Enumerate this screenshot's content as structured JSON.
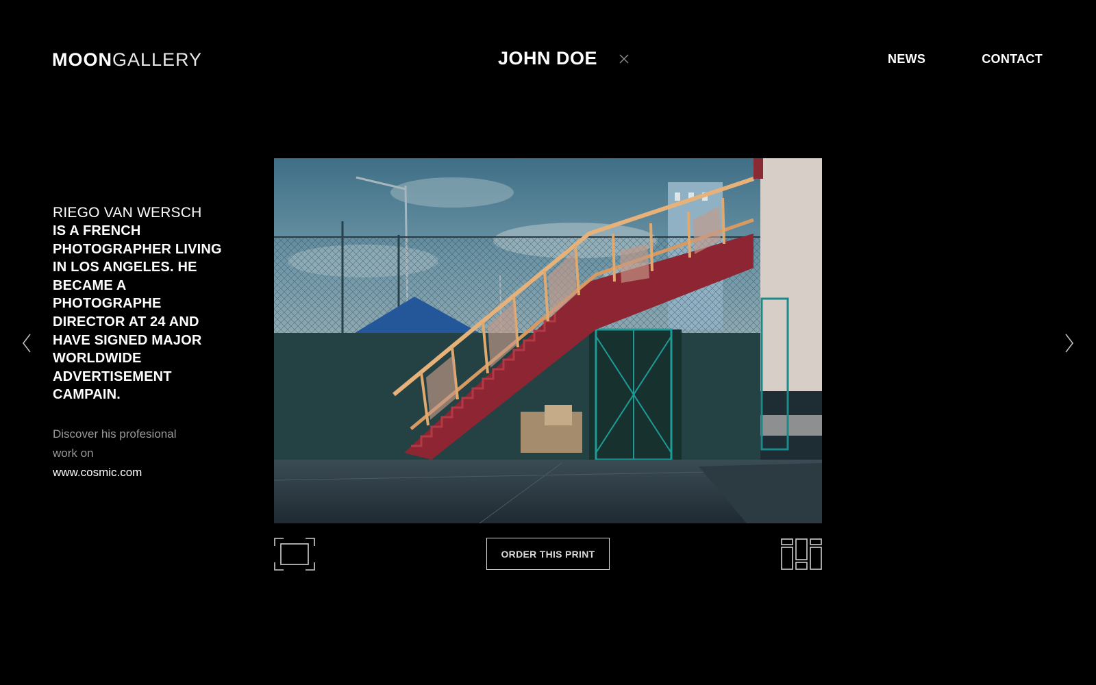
{
  "header": {
    "logo_bold": "MOON",
    "logo_thin": "GALLERY",
    "title": "JOHN DOE",
    "close_icon": "close-icon",
    "nav": [
      {
        "label": "NEWS"
      },
      {
        "label": "CONTACT"
      }
    ]
  },
  "bio": {
    "name": "RIEGO VAN WERSCH",
    "text": "IS A FRENCH PHOTOGRAPHER LIVING IN LOS ANGELES. HE BECAME A PHOTOGRAPHE DIRECTOR AT 24 AND HAVE SIGNED MAJOR WORLDWIDE ADVERTISEMENT CAMPAIN.",
    "cta": "Discover his profesional work on",
    "link": "www.cosmic.com"
  },
  "gallery": {
    "prev_icon": "chevron-left-icon",
    "next_icon": "chevron-right-icon",
    "photo_icon": "photograph",
    "fullscreen_icon": "fullscreen-icon",
    "grid_icon": "grid-view-icon",
    "order_label": "ORDER THIS PRINT"
  },
  "colors": {
    "background": "#000000",
    "text": "#ffffff",
    "muted": "#9a9a9a",
    "icon": "#cfcfcf"
  }
}
